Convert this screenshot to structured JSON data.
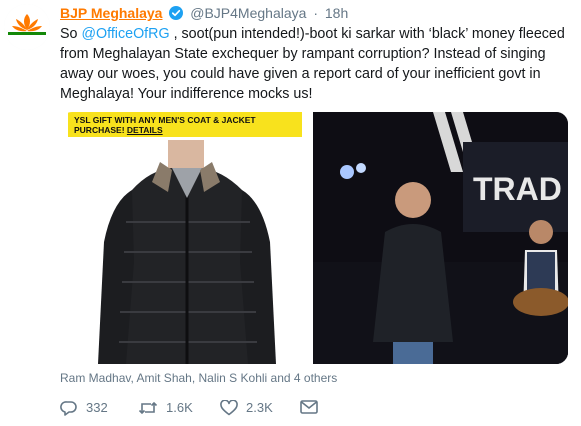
{
  "tweet": {
    "display_name": "BJP Meghalaya",
    "handle": "@BJP4Meghalaya",
    "separator": "·",
    "timestamp": "18h",
    "text_prefix": "So ",
    "mention": "@OfficeOfRG",
    "text_body": " , soot(pun intended!)-boot ki sarkar with ‘black’ money fleeced from Meghalayan State exchequer by rampant corruption? Instead of singing away our woes, you could have given a report card of your inefficient govt in Meghalaya! Your indifference mocks us!"
  },
  "media": {
    "promo_banner": "YSL GIFT WITH ANY MEN'S COAT & JACKET PURCHASE!",
    "promo_link": "DETAILS",
    "stage_sign": "TRAD"
  },
  "liked_by": "Ram Madhav, Amit Shah, Nalin S Kohli and 4 others",
  "actions": {
    "replies": "332",
    "retweets": "1.6K",
    "likes": "2.3K"
  },
  "colors": {
    "brand": "#ff7a00",
    "link": "#1da1f2",
    "muted": "#657786",
    "verified": "#1da1f2"
  },
  "icons": [
    "bjp-logo-icon",
    "verified-icon",
    "reply-icon",
    "retweet-icon",
    "like-icon",
    "dm-icon"
  ]
}
